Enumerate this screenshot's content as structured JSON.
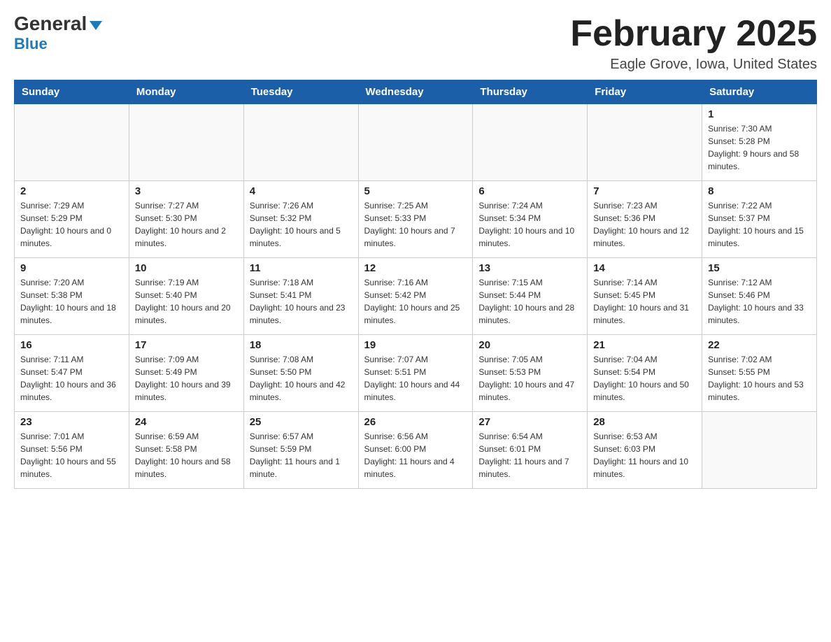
{
  "header": {
    "logo_general": "General",
    "logo_blue": "Blue",
    "title": "February 2025",
    "location": "Eagle Grove, Iowa, United States"
  },
  "days_of_week": [
    "Sunday",
    "Monday",
    "Tuesday",
    "Wednesday",
    "Thursday",
    "Friday",
    "Saturday"
  ],
  "weeks": [
    [
      {
        "day": "",
        "info": ""
      },
      {
        "day": "",
        "info": ""
      },
      {
        "day": "",
        "info": ""
      },
      {
        "day": "",
        "info": ""
      },
      {
        "day": "",
        "info": ""
      },
      {
        "day": "",
        "info": ""
      },
      {
        "day": "1",
        "info": "Sunrise: 7:30 AM\nSunset: 5:28 PM\nDaylight: 9 hours and 58 minutes."
      }
    ],
    [
      {
        "day": "2",
        "info": "Sunrise: 7:29 AM\nSunset: 5:29 PM\nDaylight: 10 hours and 0 minutes."
      },
      {
        "day": "3",
        "info": "Sunrise: 7:27 AM\nSunset: 5:30 PM\nDaylight: 10 hours and 2 minutes."
      },
      {
        "day": "4",
        "info": "Sunrise: 7:26 AM\nSunset: 5:32 PM\nDaylight: 10 hours and 5 minutes."
      },
      {
        "day": "5",
        "info": "Sunrise: 7:25 AM\nSunset: 5:33 PM\nDaylight: 10 hours and 7 minutes."
      },
      {
        "day": "6",
        "info": "Sunrise: 7:24 AM\nSunset: 5:34 PM\nDaylight: 10 hours and 10 minutes."
      },
      {
        "day": "7",
        "info": "Sunrise: 7:23 AM\nSunset: 5:36 PM\nDaylight: 10 hours and 12 minutes."
      },
      {
        "day": "8",
        "info": "Sunrise: 7:22 AM\nSunset: 5:37 PM\nDaylight: 10 hours and 15 minutes."
      }
    ],
    [
      {
        "day": "9",
        "info": "Sunrise: 7:20 AM\nSunset: 5:38 PM\nDaylight: 10 hours and 18 minutes."
      },
      {
        "day": "10",
        "info": "Sunrise: 7:19 AM\nSunset: 5:40 PM\nDaylight: 10 hours and 20 minutes."
      },
      {
        "day": "11",
        "info": "Sunrise: 7:18 AM\nSunset: 5:41 PM\nDaylight: 10 hours and 23 minutes."
      },
      {
        "day": "12",
        "info": "Sunrise: 7:16 AM\nSunset: 5:42 PM\nDaylight: 10 hours and 25 minutes."
      },
      {
        "day": "13",
        "info": "Sunrise: 7:15 AM\nSunset: 5:44 PM\nDaylight: 10 hours and 28 minutes."
      },
      {
        "day": "14",
        "info": "Sunrise: 7:14 AM\nSunset: 5:45 PM\nDaylight: 10 hours and 31 minutes."
      },
      {
        "day": "15",
        "info": "Sunrise: 7:12 AM\nSunset: 5:46 PM\nDaylight: 10 hours and 33 minutes."
      }
    ],
    [
      {
        "day": "16",
        "info": "Sunrise: 7:11 AM\nSunset: 5:47 PM\nDaylight: 10 hours and 36 minutes."
      },
      {
        "day": "17",
        "info": "Sunrise: 7:09 AM\nSunset: 5:49 PM\nDaylight: 10 hours and 39 minutes."
      },
      {
        "day": "18",
        "info": "Sunrise: 7:08 AM\nSunset: 5:50 PM\nDaylight: 10 hours and 42 minutes."
      },
      {
        "day": "19",
        "info": "Sunrise: 7:07 AM\nSunset: 5:51 PM\nDaylight: 10 hours and 44 minutes."
      },
      {
        "day": "20",
        "info": "Sunrise: 7:05 AM\nSunset: 5:53 PM\nDaylight: 10 hours and 47 minutes."
      },
      {
        "day": "21",
        "info": "Sunrise: 7:04 AM\nSunset: 5:54 PM\nDaylight: 10 hours and 50 minutes."
      },
      {
        "day": "22",
        "info": "Sunrise: 7:02 AM\nSunset: 5:55 PM\nDaylight: 10 hours and 53 minutes."
      }
    ],
    [
      {
        "day": "23",
        "info": "Sunrise: 7:01 AM\nSunset: 5:56 PM\nDaylight: 10 hours and 55 minutes."
      },
      {
        "day": "24",
        "info": "Sunrise: 6:59 AM\nSunset: 5:58 PM\nDaylight: 10 hours and 58 minutes."
      },
      {
        "day": "25",
        "info": "Sunrise: 6:57 AM\nSunset: 5:59 PM\nDaylight: 11 hours and 1 minute."
      },
      {
        "day": "26",
        "info": "Sunrise: 6:56 AM\nSunset: 6:00 PM\nDaylight: 11 hours and 4 minutes."
      },
      {
        "day": "27",
        "info": "Sunrise: 6:54 AM\nSunset: 6:01 PM\nDaylight: 11 hours and 7 minutes."
      },
      {
        "day": "28",
        "info": "Sunrise: 6:53 AM\nSunset: 6:03 PM\nDaylight: 11 hours and 10 minutes."
      },
      {
        "day": "",
        "info": ""
      }
    ]
  ]
}
